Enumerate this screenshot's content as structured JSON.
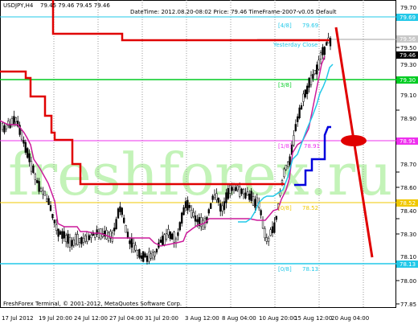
{
  "header": {
    "symbol": "USDJPY,H4",
    "ohlc": "79.45 79.46 79.45 79.46",
    "indicator_info": "DateTime: 2012.08.20-08:02   Price: 79.46   TimeFrame-2007-v0.05   Default"
  },
  "watermark": "freshforex.ru",
  "footer": "FreshForex Terminal, © 2001-2012, MetaQuotes Software Corp.",
  "colors": {
    "bull": "#ffffff",
    "bear": "#000000",
    "resistance": "#e00000",
    "support": "#0000dd",
    "trend_top": "#e0003a",
    "trend_mid": "#ee30ee",
    "trend_bottom": "#00cc22",
    "trend_lower_alt": "#22c8e8"
  },
  "chart_data": {
    "type": "candlestick",
    "y_ticks": [
      "79.70",
      "79.50",
      "79.30",
      "79.10",
      "78.90",
      "78.70",
      "78.60",
      "78.40",
      "78.30",
      "78.10",
      "78.00",
      "77.85"
    ],
    "x_ticks": [
      "17 Jul 2012",
      "19 Jul 20:00",
      "24 Jul 12:00",
      "27 Jul 04:00",
      "31 Jul 20:00",
      "3 Aug 12:00",
      "8 Aug 04:00",
      "10 Aug 20:00",
      "15 Aug 12:00",
      "20 Aug 04:00"
    ],
    "price_tags": [
      {
        "label": "79.69",
        "color": "#22c8e8"
      },
      {
        "label": "79.56",
        "color": "#ffffff"
      },
      {
        "label": "79.46",
        "color": "#000000"
      },
      {
        "label": "79.30",
        "color": "#00cc22"
      },
      {
        "label": "78.91",
        "color": "#ee30ee"
      },
      {
        "label": "78.52",
        "color": "#f0c800"
      },
      {
        "label": "78.13",
        "color": "#22c8e8"
      }
    ],
    "levels": [
      {
        "name": "[4/8]",
        "value": "79.69",
        "color": "#22c8e8"
      },
      {
        "name": "[3/8]",
        "value": "79.30",
        "color": "#00cc22"
      },
      {
        "name": "[1/8]",
        "value": "78.91",
        "color": "#ee30ee"
      },
      {
        "name": "[0/8]",
        "value": "78.52",
        "color": "#f0c800"
      },
      {
        "name": "[0/8]",
        "value": "78.13",
        "color": "#22c8e8"
      }
    ],
    "yesterday_close_label": "Yesterday Close"
  }
}
